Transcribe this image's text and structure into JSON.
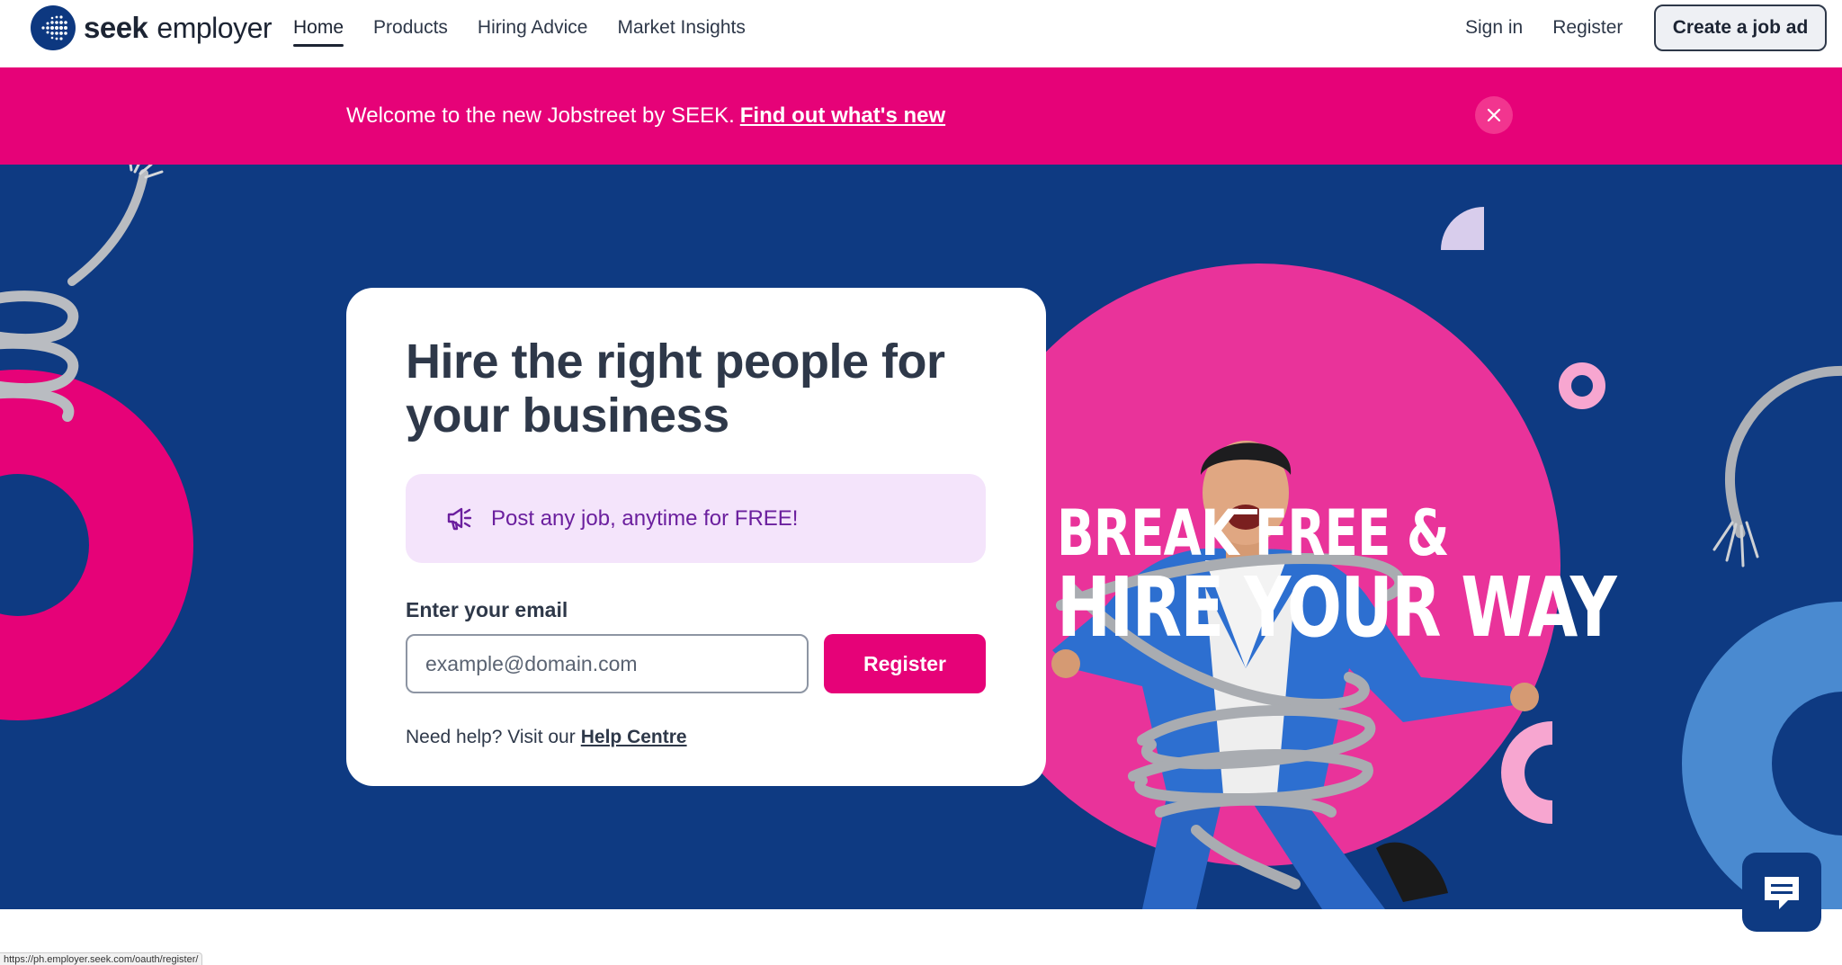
{
  "header": {
    "logo_seek": "seek",
    "logo_employer": "employer",
    "nav": [
      {
        "label": "Home",
        "active": true
      },
      {
        "label": "Products"
      },
      {
        "label": "Hiring Advice"
      },
      {
        "label": "Market Insights"
      }
    ],
    "sign_in": "Sign in",
    "register": "Register",
    "create_job_ad": "Create a job ad"
  },
  "banner": {
    "text": "Welcome to the new Jobstreet by SEEK.",
    "link": "Find out what's new",
    "close_icon": "close-icon",
    "color": "#e60278"
  },
  "hero": {
    "title": "Hire the right people for your business",
    "promo_text": "Post any job, anytime for FREE!",
    "promo_icon": "megaphone-icon",
    "email_label": "Enter your email",
    "email_placeholder": "example@domain.com",
    "email_value": "",
    "register_button": "Register",
    "help_prefix": "Need help? Visit our",
    "help_link": "Help Centre",
    "slogan_line1": "BREAK FREE &",
    "slogan_line2": "HIRE YOUR WAY",
    "bg_color": "#0e3a82",
    "accent_color": "#e60278"
  },
  "chat": {
    "icon": "chat-icon"
  },
  "status_bar": {
    "url": "https://ph.employer.seek.com/oauth/register/"
  }
}
